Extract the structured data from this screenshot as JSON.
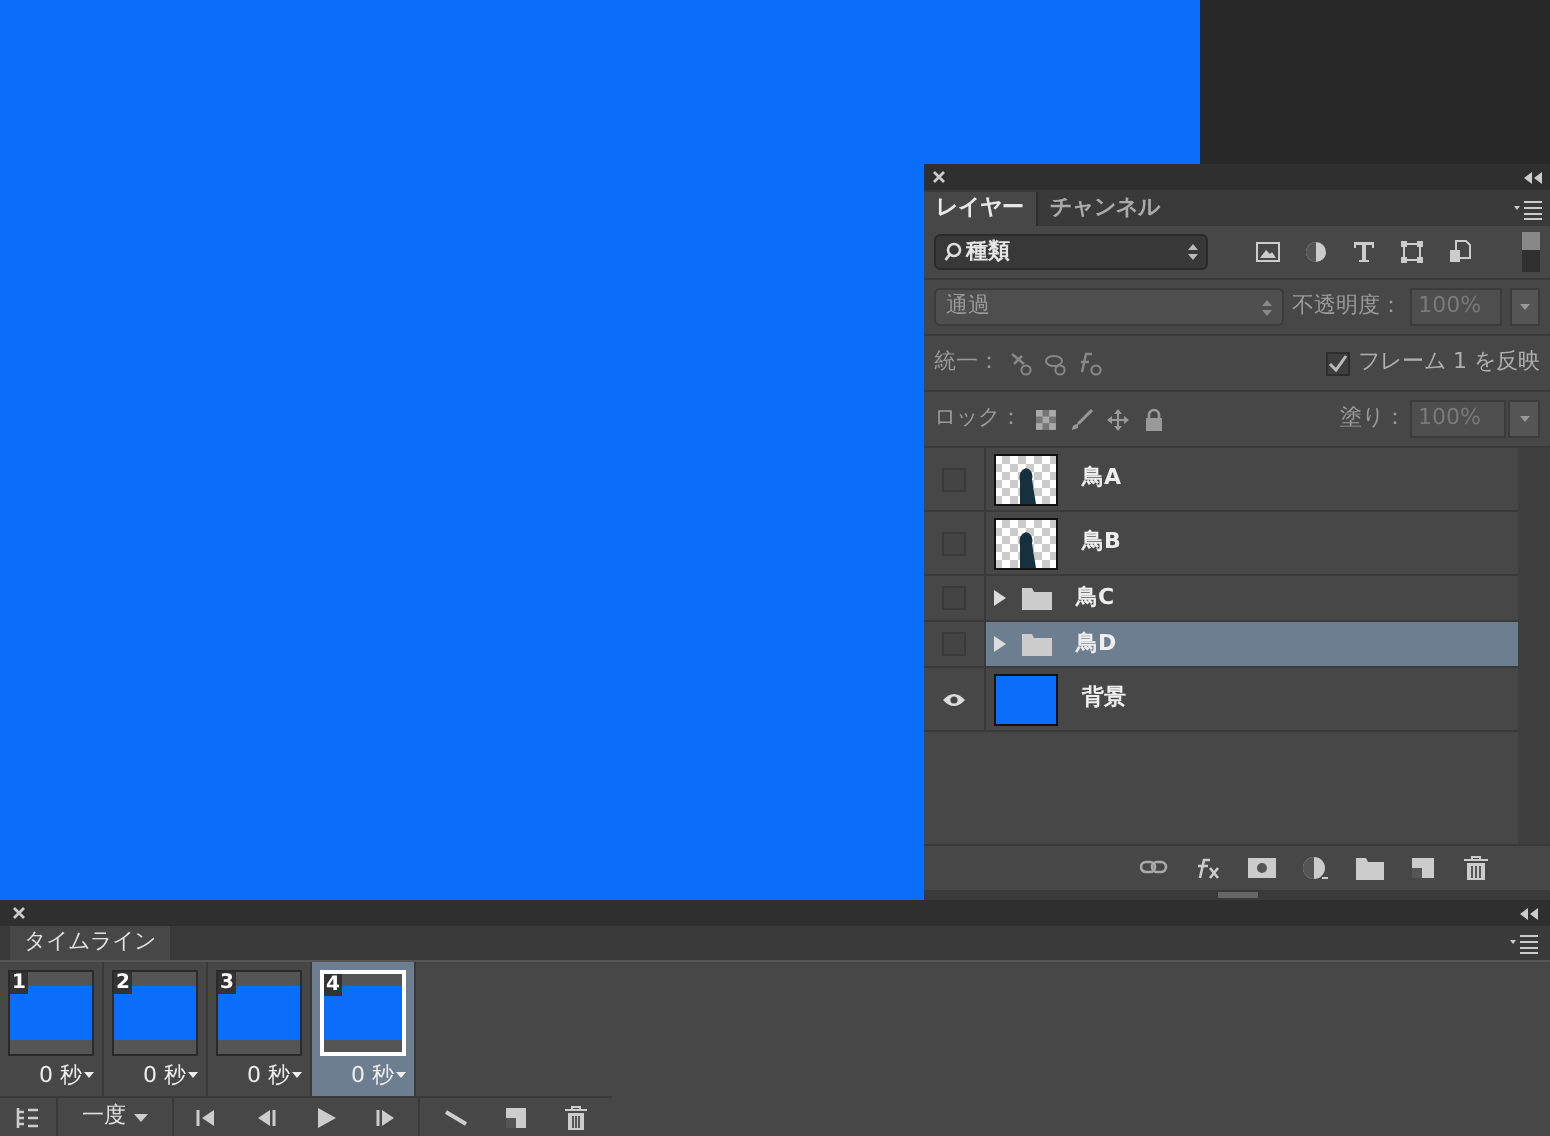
{
  "layers_panel": {
    "tabs": [
      {
        "label": "レイヤー",
        "selected": true
      },
      {
        "label": "チャンネル",
        "selected": false
      }
    ],
    "filter": {
      "value": "種類"
    },
    "blend_mode": {
      "value": "通過"
    },
    "opacity": {
      "label": "不透明度：",
      "value": "100%",
      "disabled": true
    },
    "unify": {
      "label": "統一："
    },
    "propagate": {
      "label": "フレーム 1 を反映",
      "checked": true
    },
    "lock": {
      "label": "ロック："
    },
    "fill": {
      "label": "塗り：",
      "value": "100%",
      "disabled": true
    },
    "layers": [
      {
        "name": "鳥A",
        "kind": "image",
        "visible": false,
        "selected": false
      },
      {
        "name": "鳥B",
        "kind": "image",
        "visible": false,
        "selected": false
      },
      {
        "name": "鳥C",
        "kind": "group",
        "visible": false,
        "selected": false,
        "expanded": false
      },
      {
        "name": "鳥D",
        "kind": "group",
        "visible": false,
        "selected": true,
        "expanded": false
      },
      {
        "name": "背景",
        "kind": "fill",
        "visible": true,
        "selected": false
      }
    ]
  },
  "timeline": {
    "tab": {
      "label": "タイムライン"
    },
    "frames": [
      {
        "number": "1",
        "delay": "0 秒",
        "selected": false
      },
      {
        "number": "2",
        "delay": "0 秒",
        "selected": false
      },
      {
        "number": "3",
        "delay": "0 秒",
        "selected": false
      },
      {
        "number": "4",
        "delay": "0 秒",
        "selected": true
      }
    ],
    "loop": {
      "value": "一度"
    }
  }
}
